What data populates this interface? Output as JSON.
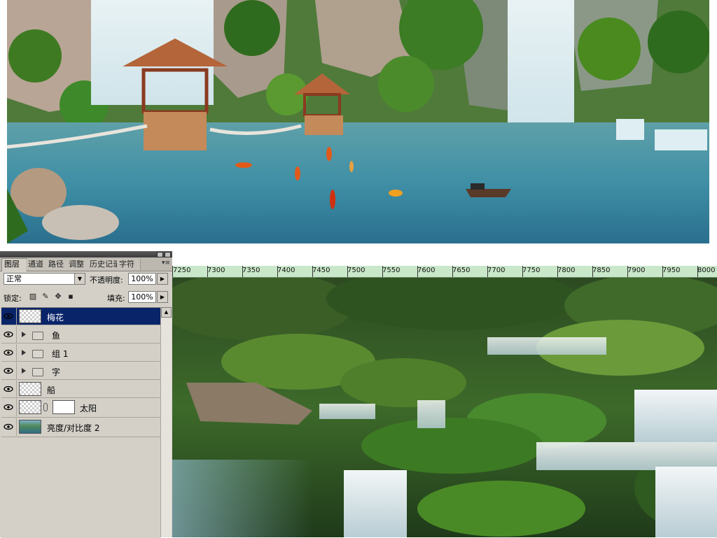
{
  "panorama": {
    "name": "landscape-panorama"
  },
  "layers_panel": {
    "tabs": [
      "图层",
      "通道",
      "路径",
      "调整",
      "历史记录",
      "字符"
    ],
    "active_tab": "图层",
    "menu_icon": "panel-menu-icon",
    "blend_mode": "正常",
    "opacity_label": "不透明度:",
    "opacity_value": "100%",
    "lock_label": "锁定:",
    "fill_label": "填充:",
    "fill_value": "100%",
    "layers": [
      {
        "name": "梅花",
        "type": "layer",
        "selected": true
      },
      {
        "name": "鱼",
        "type": "group"
      },
      {
        "name": "组 1",
        "type": "group"
      },
      {
        "name": "字",
        "type": "group"
      },
      {
        "name": "船",
        "type": "layer"
      },
      {
        "name": "太阳",
        "type": "layer-with-mask"
      },
      {
        "name": "亮度/对比度 2",
        "type": "image-layer"
      }
    ]
  },
  "ruler": {
    "labels": [
      "7250",
      "7300",
      "7350",
      "7400",
      "7450",
      "7500",
      "7550",
      "7600",
      "7650",
      "7700",
      "7750",
      "7800",
      "7850",
      "7900",
      "7950",
      "8000"
    ]
  },
  "colors": {
    "panel_bg": "#d4d0c8",
    "selection": "#0a246a",
    "ruler_bg": "#c9e7c9"
  }
}
